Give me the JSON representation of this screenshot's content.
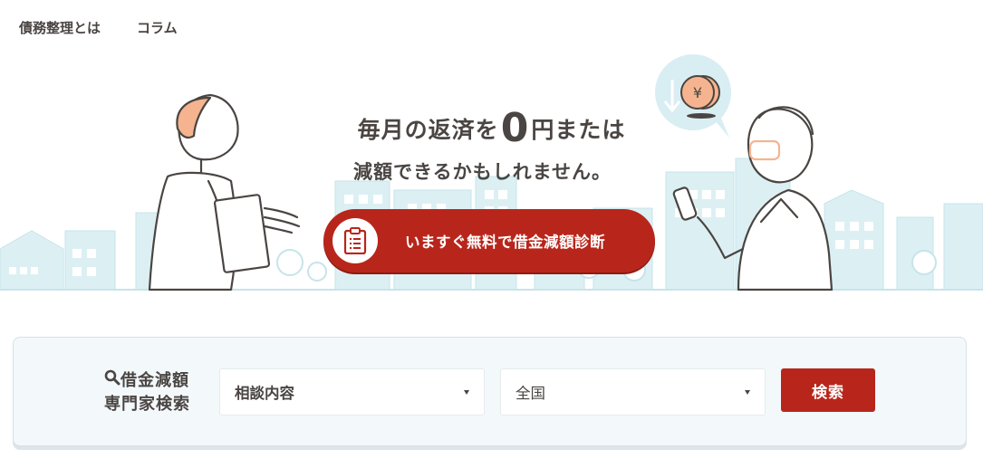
{
  "nav": {
    "items": [
      {
        "label": "債務整理とは"
      },
      {
        "label": "コラム"
      }
    ]
  },
  "hero": {
    "headline_pre": "毎月の返済を",
    "headline_big": "0",
    "headline_post": "円または",
    "headline_line2": "減額できるかもしれません。",
    "cta_label": "いますぐ無料で借金減額診断",
    "cta_icon": "clipboard-icon",
    "coin_symbol": "¥"
  },
  "search": {
    "title_line1": "借金減額",
    "title_line2": "専門家検索",
    "category_select": "相談内容",
    "region_select": "全国",
    "button_label": "検索"
  },
  "colors": {
    "accent": "#b8261b",
    "skyline": "#d9eef3",
    "panel_bg": "#f3f8fb",
    "text": "#4a4542"
  }
}
